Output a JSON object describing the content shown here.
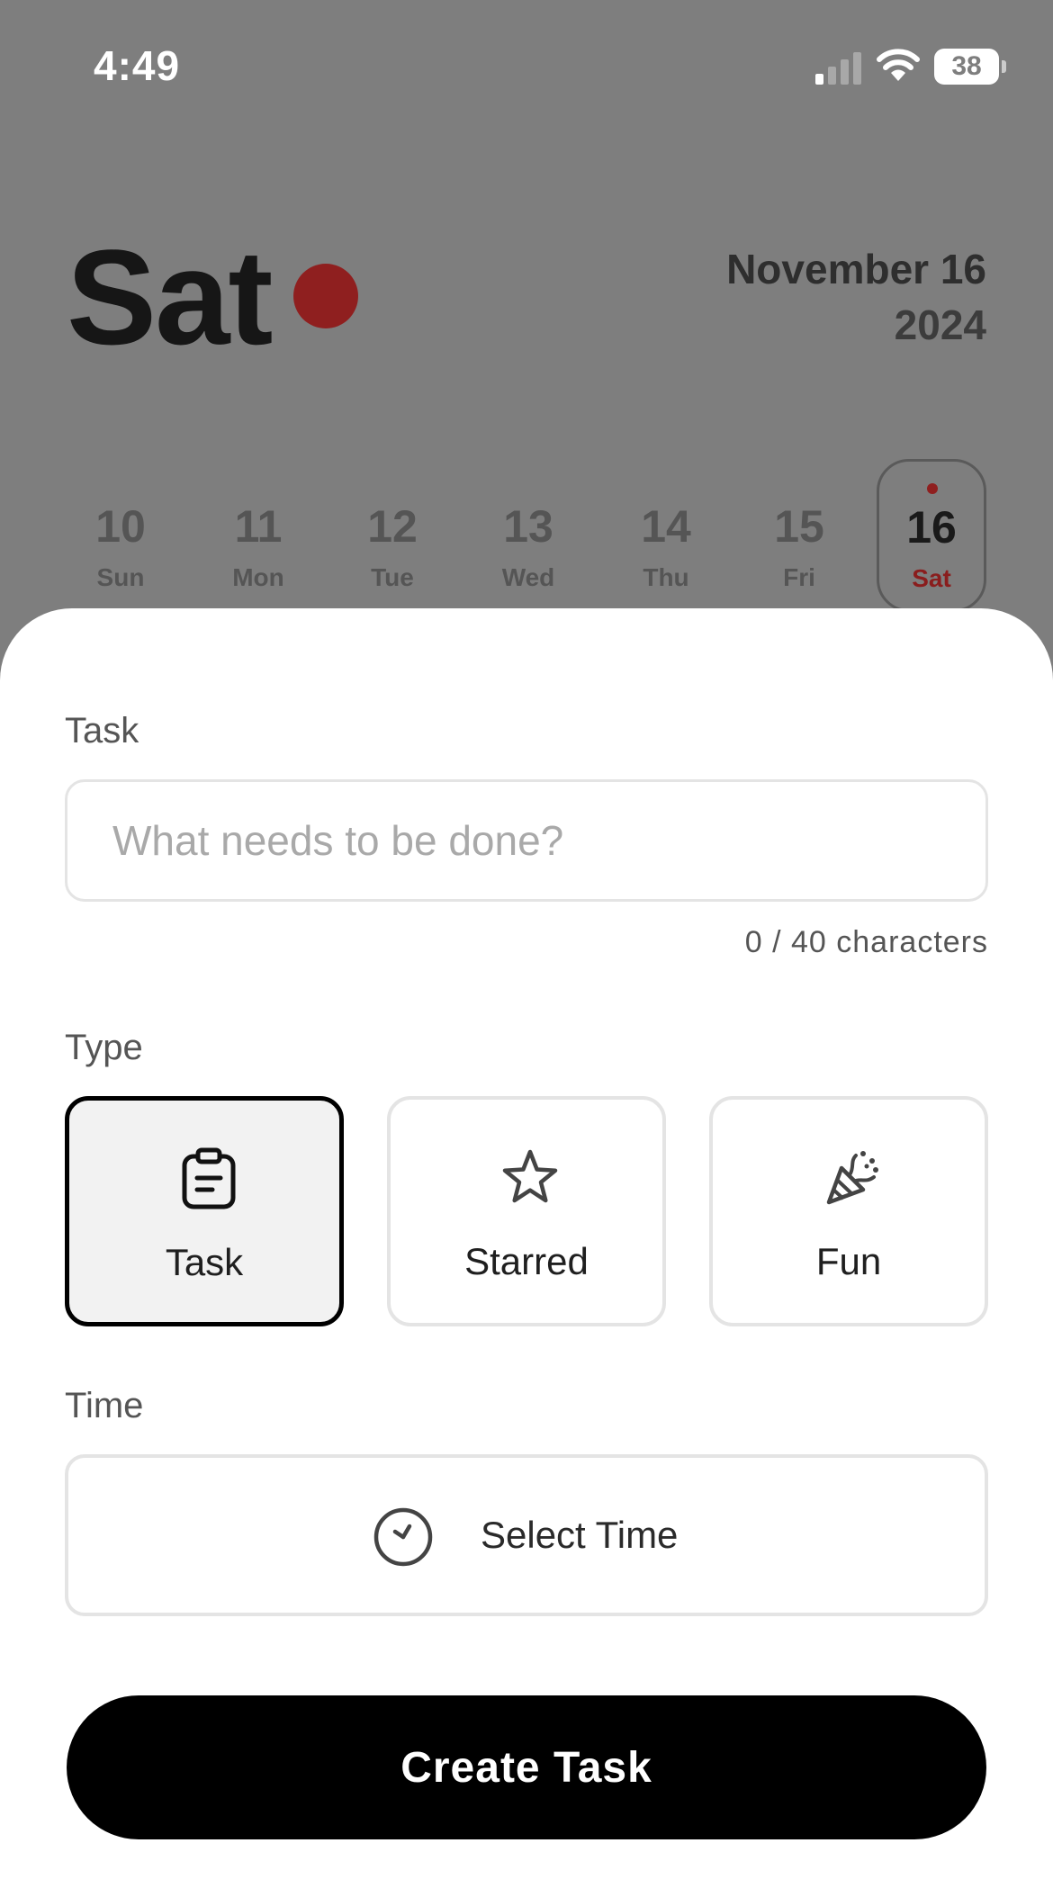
{
  "status_bar": {
    "time": "4:49",
    "battery": "38"
  },
  "header": {
    "day": "Sat",
    "month_day": "November 16",
    "year": "2024"
  },
  "week": [
    {
      "num": "10",
      "label": "Sun"
    },
    {
      "num": "11",
      "label": "Mon"
    },
    {
      "num": "12",
      "label": "Tue"
    },
    {
      "num": "13",
      "label": "Wed"
    },
    {
      "num": "14",
      "label": "Thu"
    },
    {
      "num": "15",
      "label": "Fri"
    },
    {
      "num": "16",
      "label": "Sat",
      "selected": true
    }
  ],
  "form": {
    "task_label": "Task",
    "task_placeholder": "What needs to be done?",
    "task_value": "",
    "char_count": "0 / 40 characters",
    "type_label": "Type",
    "types": [
      {
        "label": "Task",
        "icon": "clipboard-icon",
        "selected": true
      },
      {
        "label": "Starred",
        "icon": "star-icon"
      },
      {
        "label": "Fun",
        "icon": "party-popper-icon"
      }
    ],
    "time_label": "Time",
    "time_button": "Select Time",
    "submit": "Create Task"
  },
  "colors": {
    "accent": "#8f1f1f",
    "overlay": "#7e7e7e",
    "primary_button": "#000000"
  }
}
